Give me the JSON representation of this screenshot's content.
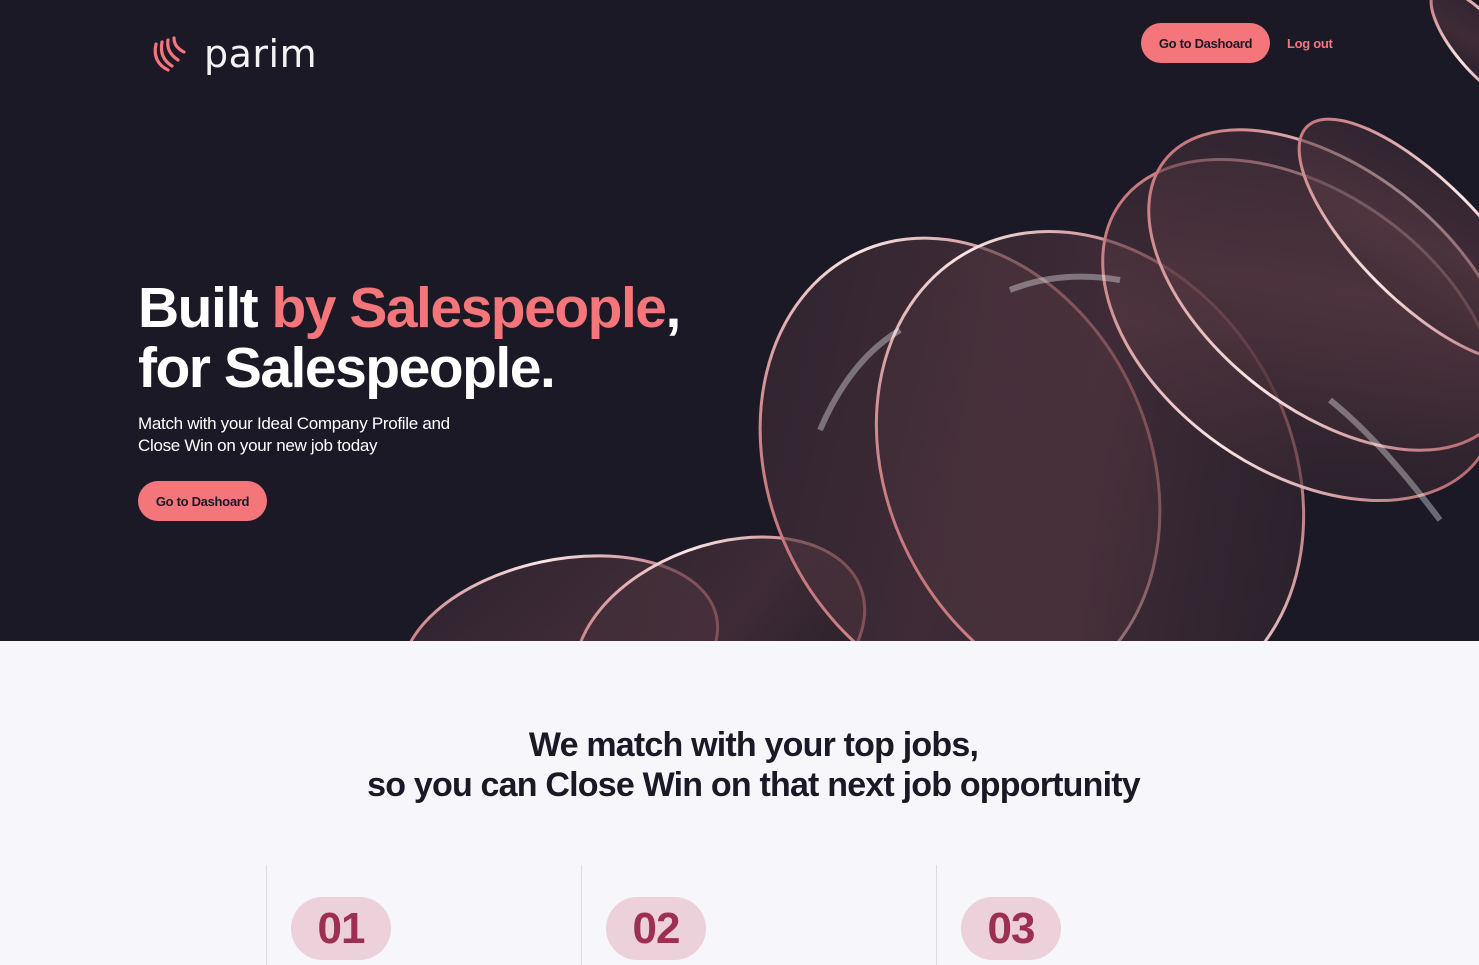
{
  "brand": {
    "name": "parim",
    "accent": "#f4757a",
    "dark": "#1c1927"
  },
  "nav": {
    "dashboard_label": "Go to Dashoard",
    "logout_label": "Log out"
  },
  "hero": {
    "headline_start": "Built ",
    "headline_accent": "by Salespeople",
    "headline_comma": ",",
    "headline_line2": "for Salespeople.",
    "subtext_line1": "Match with your Ideal Company Profile and",
    "subtext_line2": "Close Win on your new job today",
    "cta_label": "Go to Dashoard"
  },
  "section": {
    "title_line1": "We match with your top jobs,",
    "title_line2": "so you can Close Win on that next job opportunity"
  },
  "steps": [
    {
      "number": "01"
    },
    {
      "number": "02"
    },
    {
      "number": "03"
    }
  ]
}
